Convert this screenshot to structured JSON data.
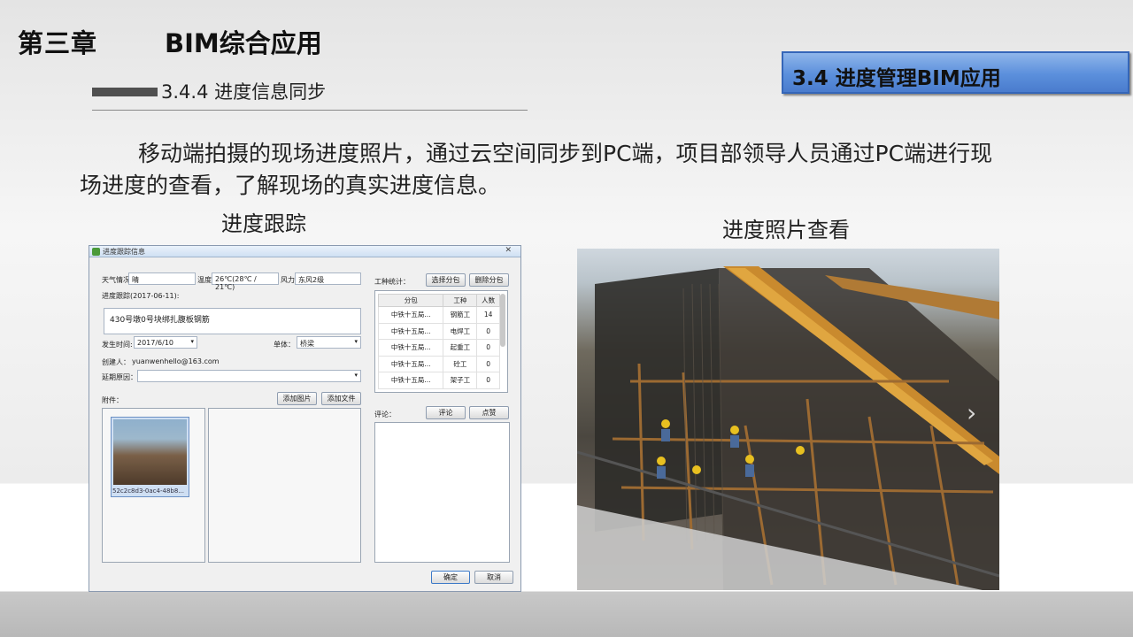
{
  "header": {
    "chapter": "第三章",
    "chapter_title": "BIM综合应用",
    "section": "3.4.4 进度信息同步",
    "badge": "3.4 进度管理BIM应用"
  },
  "body": {
    "line1": "移动端拍摄的现场进度照片，通过云空间同步到PC端，项目部领导人员通过PC端进行现",
    "line2": "场进度的查看，了解现场的真实进度信息。"
  },
  "captions": {
    "left": "进度跟踪",
    "right": "进度照片查看"
  },
  "dialog": {
    "title": "进度跟踪信息",
    "weather_label": "天气情况",
    "weather": "晴",
    "temp_label": "温度",
    "temp": "26℃(28℃ / 21℃)",
    "wind_label": "风力",
    "wind": "东风2级",
    "track_label": "进度跟踪(2017-06-11):",
    "track_text": "430号墩0号块绑扎腹板钢筋",
    "time_label": "发生时间:",
    "time": "2017/6/10",
    "unit_label": "单体：",
    "unit": "桥梁",
    "creator_label": "创建人：",
    "creator": "yuanwenhello@163.com",
    "delay_label": "延期原因：",
    "attach_label": "附件：",
    "add_image": "添加图片",
    "add_file": "添加文件",
    "thumb_name": "52c2c8d3-0ac4-48b8...",
    "workers_label": "工种统计：",
    "select_btn": "选择分包",
    "delete_btn": "删除分包",
    "columns": [
      "分包",
      "工种",
      "人数"
    ],
    "rows": [
      [
        "中铁十五局...",
        "钢筋工",
        "14"
      ],
      [
        "中铁十五局...",
        "电焊工",
        "0"
      ],
      [
        "中铁十五局...",
        "起重工",
        "0"
      ],
      [
        "中铁十五局...",
        "砼工",
        "0"
      ],
      [
        "中铁十五局...",
        "架子工",
        "0"
      ]
    ],
    "comment_label": "评论：",
    "comment_btn": "评论",
    "like_btn": "点赞",
    "ok": "确定",
    "cancel": "取消"
  }
}
